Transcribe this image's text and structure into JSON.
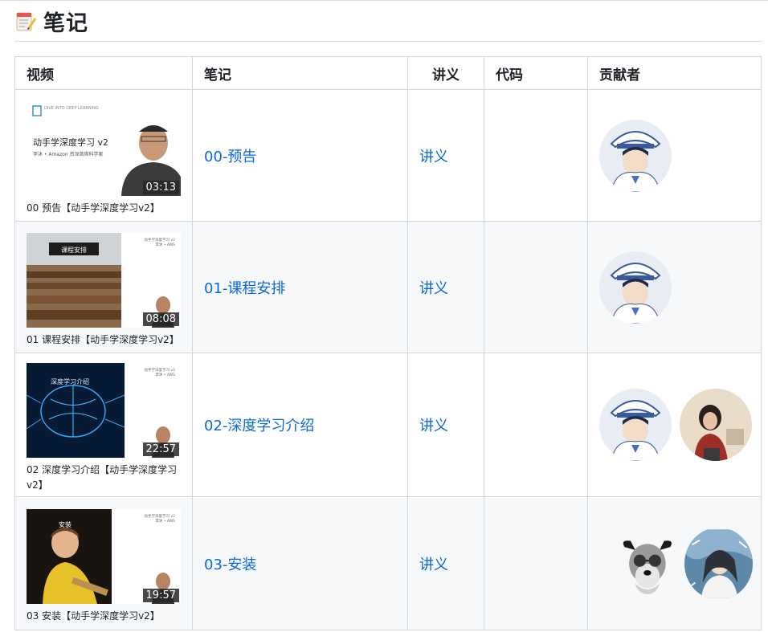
{
  "page": {
    "title": "笔记"
  },
  "table": {
    "headers": {
      "video": "视频",
      "notes": "笔记",
      "lecture": "讲义",
      "code": "代码",
      "contributors": "贡献者"
    },
    "rows": [
      {
        "video_title": "00 预告【动手学深度学习v2】",
        "duration": "03:13",
        "note": "00-预告",
        "lecture": "讲义",
        "code": "",
        "thumb_title": "动手学深度学习 v2",
        "thumb_subtitle": "李沐 • Amazon 资深首席科学家",
        "thumb_brand": "DIVE INTO DEEP LEARNING"
      },
      {
        "video_title": "01 课程安排【动手学深度学习v2】",
        "duration": "08:08",
        "note": "01-课程安排",
        "lecture": "讲义",
        "code": "",
        "thumb_caption": "课程安排",
        "thumb_side": "动手学深度学习 v2",
        "thumb_side2": "李沐 • AWS"
      },
      {
        "video_title": "02 深度学习介绍【动手学深度学习v2】",
        "duration": "22:57",
        "note": "02-深度学习介绍",
        "lecture": "讲义",
        "code": "",
        "thumb_caption": "深度学习介绍",
        "thumb_side": "动手学深度学习 v2",
        "thumb_side2": "李沐 • AWS"
      },
      {
        "video_title": "03 安装【动手学深度学习v2】",
        "duration": "19:57",
        "note": "03-安装",
        "lecture": "讲义",
        "code": "",
        "thumb_caption": "安装",
        "thumb_side": "动手学深度学习 v2",
        "thumb_side2": "李沐 • AWS"
      }
    ]
  },
  "colors": {
    "link": "#0969da",
    "border": "#d0d7de",
    "stripe": "#f6f8fa"
  }
}
